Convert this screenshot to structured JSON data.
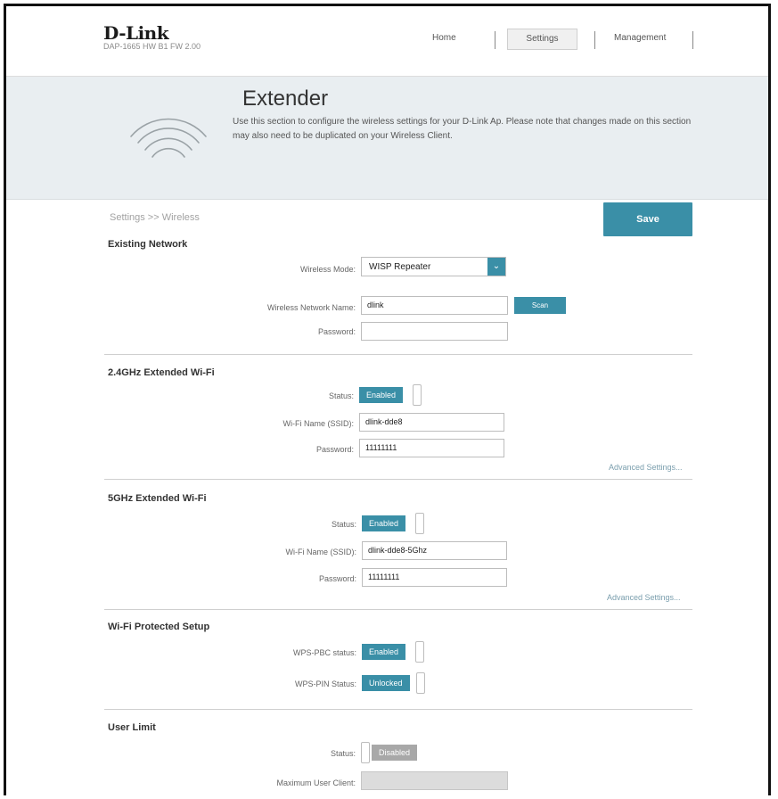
{
  "header": {
    "brand": "D-Link",
    "model": "DAP-1665 HW B1 FW 2.00",
    "nav": {
      "home": "Home",
      "settings": "Settings",
      "management": "Management"
    }
  },
  "hero": {
    "title": "Extender",
    "description": "Use this section to configure the wireless settings for your D-Link Ap. Please note that changes made on this section may also need to be duplicated on your Wireless Client.",
    "icon": "wifi-icon"
  },
  "breadcrumb": "Settings >> Wireless",
  "save_label": "Save",
  "existing": {
    "title": "Existing Network",
    "mode_label": "Wireless Mode:",
    "mode_value": "WISP Repeater",
    "name_label": "Wireless Network Name:",
    "name_value": "dlink",
    "scan_label": "Scan",
    "password_label": "Password:",
    "password_value": ""
  },
  "wifi24": {
    "title": "2.4GHz Extended Wi-Fi",
    "status_label": "Status:",
    "status_value": "Enabled",
    "ssid_label": "Wi-Fi Name (SSID):",
    "ssid_value": "dlink-dde8",
    "password_label": "Password:",
    "password_value": "11111111",
    "advanced": "Advanced Settings..."
  },
  "wifi5": {
    "title": "5GHz Extended Wi-Fi",
    "status_label": "Status:",
    "status_value": "Enabled",
    "ssid_label": "Wi-Fi Name (SSID):",
    "ssid_value": "dlink-dde8-5Ghz",
    "password_label": "Password:",
    "password_value": "11111111",
    "advanced": "Advanced Settings..."
  },
  "wps": {
    "title": "Wi-Fi Protected Setup",
    "pbc_label": "WPS-PBC status:",
    "pbc_value": "Enabled",
    "pin_label": "WPS-PIN Status:",
    "pin_value": "Unlocked"
  },
  "userlimit": {
    "title": "User Limit",
    "status_label": "Status:",
    "status_value": "Disabled",
    "max_label": "Maximum User Client:",
    "max_value": ""
  },
  "colors": {
    "accent": "#3a8fa7",
    "hero_bg": "#e9eef1"
  }
}
